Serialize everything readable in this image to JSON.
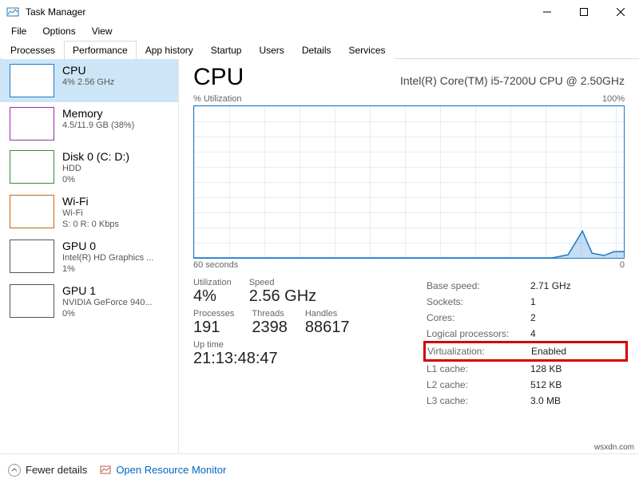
{
  "window": {
    "title": "Task Manager"
  },
  "menu": {
    "file": "File",
    "options": "Options",
    "view": "View"
  },
  "tabs": {
    "processes": "Processes",
    "performance": "Performance",
    "apphistory": "App history",
    "startup": "Startup",
    "users": "Users",
    "details": "Details",
    "services": "Services"
  },
  "sidebar": [
    {
      "title": "CPU",
      "sub1": "4% 2.56 GHz",
      "sub2": ""
    },
    {
      "title": "Memory",
      "sub1": "4.5/11.9 GB (38%)",
      "sub2": ""
    },
    {
      "title": "Disk 0 (C: D:)",
      "sub1": "HDD",
      "sub2": "0%"
    },
    {
      "title": "Wi-Fi",
      "sub1": "Wi-Fi",
      "sub2": "S: 0 R: 0 Kbps"
    },
    {
      "title": "GPU 0",
      "sub1": "Intel(R) HD Graphics ...",
      "sub2": "1%"
    },
    {
      "title": "GPU 1",
      "sub1": "NVIDIA GeForce 940...",
      "sub2": "0%"
    }
  ],
  "main": {
    "heading": "CPU",
    "model": "Intel(R) Core(TM) i5-7200U CPU @ 2.50GHz",
    "chart_top_left": "% Utilization",
    "chart_top_right": "100%",
    "chart_bot_left": "60 seconds",
    "chart_bot_right": "0",
    "left": {
      "util_lbl": "Utilization",
      "util_val": "4%",
      "speed_lbl": "Speed",
      "speed_val": "2.56 GHz",
      "proc_lbl": "Processes",
      "proc_val": "191",
      "thr_lbl": "Threads",
      "thr_val": "2398",
      "hnd_lbl": "Handles",
      "hnd_val": "88617",
      "up_lbl": "Up time",
      "up_val": "21:13:48:47"
    },
    "right": {
      "base_k": "Base speed:",
      "base_v": "2.71 GHz",
      "sock_k": "Sockets:",
      "sock_v": "1",
      "core_k": "Cores:",
      "core_v": "2",
      "lp_k": "Logical processors:",
      "lp_v": "4",
      "virt_k": "Virtualization:",
      "virt_v": "Enabled",
      "l1_k": "L1 cache:",
      "l1_v": "128 KB",
      "l2_k": "L2 cache:",
      "l2_v": "512 KB",
      "l3_k": "L3 cache:",
      "l3_v": "3.0 MB"
    }
  },
  "footer": {
    "fewer": "Fewer details",
    "orm": "Open Resource Monitor"
  },
  "watermark": "wsxdn.com",
  "chart_data": {
    "type": "line",
    "title": "% Utilization",
    "xlabel": "60 seconds",
    "ylabel": "",
    "ylim": [
      0,
      100
    ],
    "x": [
      0,
      5,
      10,
      15,
      20,
      25,
      30,
      35,
      40,
      45,
      50,
      53,
      55,
      57,
      59,
      60
    ],
    "series": [
      {
        "name": "CPU %",
        "values": [
          0,
          0,
          0,
          0,
          0,
          0,
          0,
          0,
          0,
          0,
          0,
          2,
          18,
          4,
          2,
          4
        ]
      }
    ]
  }
}
